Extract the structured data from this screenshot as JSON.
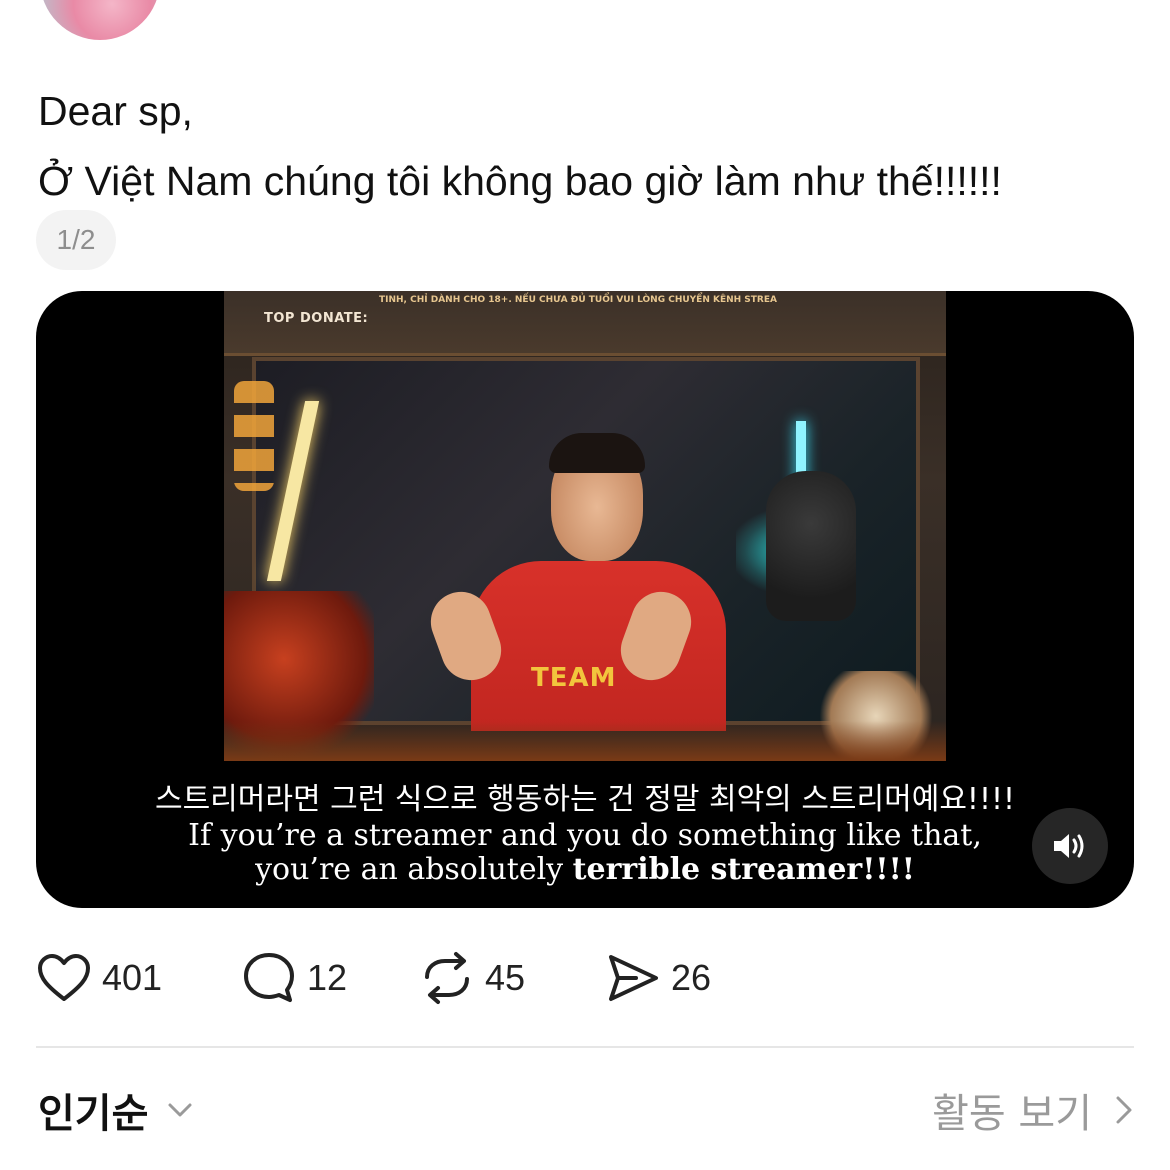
{
  "post": {
    "line1": "Dear sp,",
    "line2": "Ở Việt Nam chúng tôi không bao giờ làm như thế!!!!!!",
    "page_indicator": "1/2"
  },
  "video": {
    "overlay_top_donate": "TOP DONATE:",
    "overlay_ticker": "TINH, CHỈ DÀNH CHO 18+. NẾU CHƯA ĐỦ TUỔI VUI LÒNG CHUYỂN KÊNH        STREA",
    "jersey_text": "TEAM",
    "caption_korean": "스트리머라면 그런 식으로 행동하는 건 정말 최악의 스트리머예요!!!!",
    "caption_english_line1": "If you’re a streamer and you do something like that,",
    "caption_english_line2_pre": "you’re an absolutely ",
    "caption_english_line2_bold": "terrible streamer!!!!",
    "volume_icon": "speaker-on-icon"
  },
  "actions": {
    "like_count": "401",
    "reply_count": "12",
    "repost_count": "45",
    "share_count": "26",
    "like_icon": "heart-icon",
    "reply_icon": "speech-bubble-icon",
    "repost_icon": "repost-icon",
    "share_icon": "paper-plane-icon"
  },
  "footer": {
    "sort_label": "인기순",
    "activity_label": "활동 보기"
  }
}
